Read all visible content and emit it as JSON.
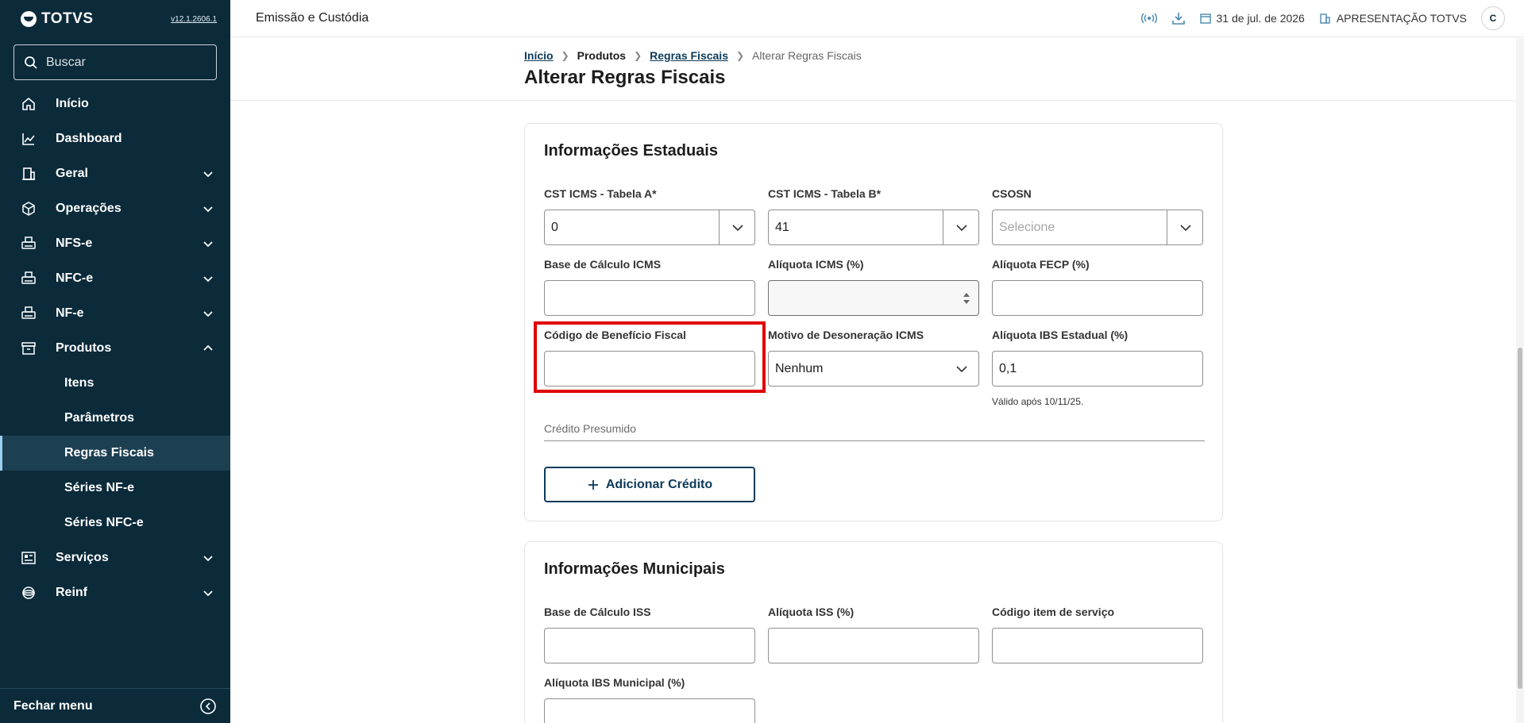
{
  "sidebar": {
    "brand": "TOTVS",
    "version": "v12.1.2606.1",
    "search_placeholder": "Buscar",
    "items": [
      {
        "label": "Início",
        "icon": "home-icon"
      },
      {
        "label": "Dashboard",
        "icon": "chart-line-icon"
      },
      {
        "label": "Geral",
        "icon": "building-icon"
      },
      {
        "label": "Operações",
        "icon": "cube-icon"
      },
      {
        "label": "NFS-e",
        "icon": "printer-icon"
      },
      {
        "label": "NFC-e",
        "icon": "printer-icon"
      },
      {
        "label": "NF-e",
        "icon": "printer-icon"
      },
      {
        "label": "Produtos",
        "icon": "archive-icon"
      },
      {
        "label": "Serviços",
        "icon": "newspaper-icon"
      },
      {
        "label": "Reinf",
        "icon": "globe-icon"
      }
    ],
    "subitems": [
      {
        "label": "Itens"
      },
      {
        "label": "Parâmetros"
      },
      {
        "label": "Regras Fiscais"
      },
      {
        "label": "Séries NF-e"
      },
      {
        "label": "Séries NFC-e"
      }
    ],
    "footer_label": "Fechar menu"
  },
  "header": {
    "title": "Emissão e Custódia",
    "date": "31 de jul. de 2026",
    "company": "APRESENTAÇÃO TOTVS",
    "avatar_initial": "C"
  },
  "page": {
    "breadcrumb": {
      "home": "Início",
      "products": "Produtos",
      "rules": "Regras Fiscais",
      "current": "Alterar Regras Fiscais"
    },
    "title": "Alterar Regras Fiscais"
  },
  "estaduais": {
    "title": "Informações Estaduais",
    "cst_a": {
      "label": "CST ICMS - Tabela A*",
      "value": "0"
    },
    "cst_b": {
      "label": "CST ICMS - Tabela B*",
      "value": "41"
    },
    "csosn": {
      "label": "CSOSN",
      "placeholder": "Selecione"
    },
    "base_icms": {
      "label": "Base de Cálculo ICMS",
      "value": ""
    },
    "aliquota_icms": {
      "label": "Alíquota ICMS (%)",
      "value": ""
    },
    "aliquota_fecp": {
      "label": "Alíquota FECP (%)",
      "value": ""
    },
    "beneficio": {
      "label": "Código de Benefício Fiscal",
      "value": ""
    },
    "desoneracao": {
      "label": "Motivo de Desoneração ICMS",
      "value": "Nenhum"
    },
    "ibs_estadual": {
      "label": "Alíquota IBS Estadual (%)",
      "value": "0,1",
      "help": "Válido após 10/11/25."
    },
    "credito_label": "Crédito Presumido",
    "add_credit_label": "Adicionar Crédito"
  },
  "municipais": {
    "title": "Informações Municipais",
    "base_iss": {
      "label": "Base de Cálculo ISS",
      "value": ""
    },
    "aliquota_iss": {
      "label": "Alíquota ISS (%)",
      "value": ""
    },
    "codigo_servico": {
      "label": "Código item de serviço",
      "value": ""
    },
    "ibs_municipal": {
      "label": "Alíquota IBS Municipal (%)",
      "value": ""
    }
  },
  "colors": {
    "sidebar_bg": "#0b2a3a",
    "active_item_bg": "#1d3f52",
    "primary": "#0b3a5a",
    "highlight": "#e00000"
  }
}
